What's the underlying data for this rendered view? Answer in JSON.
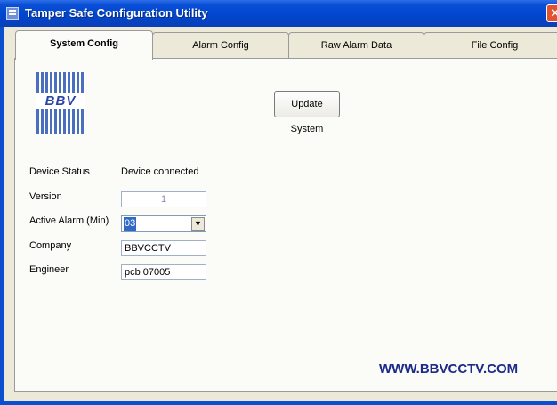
{
  "window": {
    "title": "Tamper Safe Configuration Utility",
    "close_glyph": "✕",
    "icon": "app-icon"
  },
  "tabs": [
    {
      "label": "System Config",
      "active": true
    },
    {
      "label": "Alarm Config",
      "active": false
    },
    {
      "label": "Raw Alarm Data",
      "active": false
    },
    {
      "label": "File Config",
      "active": false
    }
  ],
  "logo": {
    "text": "BBV"
  },
  "update_button": {
    "label": "Update System"
  },
  "form": {
    "device_status": {
      "label": "Device Status",
      "value": "Device connected"
    },
    "version": {
      "label": "Version",
      "value": "1"
    },
    "active_alarm": {
      "label": "Active Alarm (Min)",
      "value": "03",
      "dropdown_glyph": "▼"
    },
    "company": {
      "label": "Company",
      "value": "BBVCCTV"
    },
    "engineer": {
      "label": "Engineer",
      "value": "pcb 07005"
    }
  },
  "footer": {
    "website": "WWW.BBVCCTV.COM"
  },
  "colors": {
    "titlebar": "#0046cf",
    "accent": "#316ac5",
    "website_text": "#1c2a8a"
  }
}
